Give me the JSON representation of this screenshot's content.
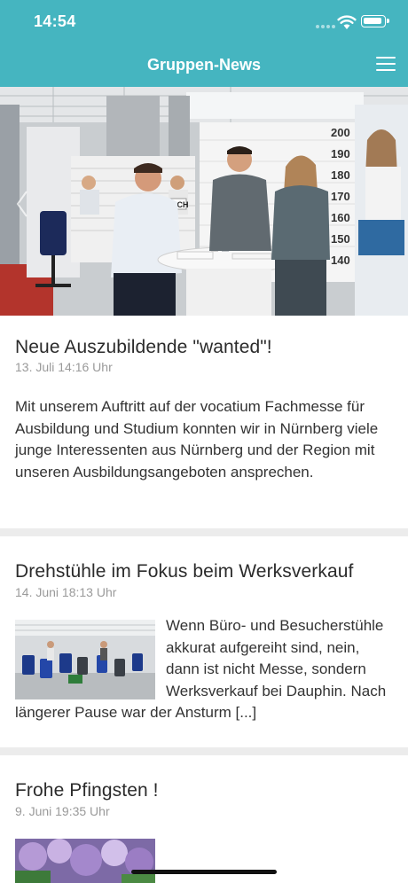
{
  "status_bar": {
    "time": "14:54"
  },
  "navbar": {
    "title": "Gruppen-News"
  },
  "posts": [
    {
      "title": "Neue Auszubildende \"wanted\"!",
      "date": "13. Juli 14:16 Uhr",
      "body": "Mit unserem Auftritt auf der vocatium Fachmesse für Ausbildung und Studium konnten wir in Nürnberg viele junge Interessenten aus Nürnberg und der Region mit unseren Ausbildungsangeboten ansprechen."
    },
    {
      "title": "Drehstühle im Fokus beim Werksverkauf",
      "date": "14. Juni 18:13 Uhr",
      "body": "Wenn Büro- und Besucherstühle akkurat aufgereiht sind, nein, dann ist nicht Messe, sondern Werksverkauf bei Dauphin. Nach längerer Pause war der Ansturm [...]"
    },
    {
      "title": "Frohe Pfingsten !",
      "date": "9. Juni 19:35 Uhr"
    }
  ],
  "hero_image": {
    "banner_text": "KOCH",
    "scale_numbers": [
      "200",
      "190",
      "180",
      "170",
      "160",
      "150",
      "140"
    ]
  }
}
